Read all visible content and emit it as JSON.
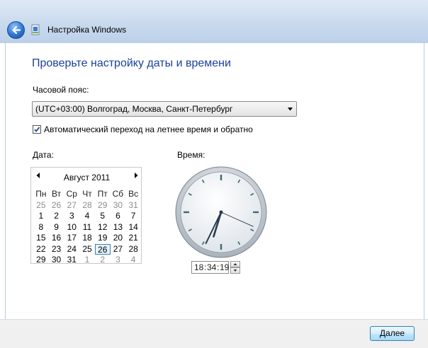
{
  "window": {
    "title": "Настройка Windows"
  },
  "page": {
    "title": "Проверьте настройку даты и времени"
  },
  "timezone": {
    "label": "Часовой пояс:",
    "value": "(UTC+03:00) Волгоград, Москва, Санкт-Петербург",
    "dst_checked": true,
    "dst_label": "Автоматический переход на летнее время и обратно"
  },
  "date": {
    "label": "Дата:",
    "month": "Август 2011",
    "weekdays": [
      "Пн",
      "Вт",
      "Ср",
      "Чт",
      "Пт",
      "Сб",
      "Вс"
    ],
    "days": [
      [
        "25",
        "26",
        "27",
        "28",
        "29",
        "30",
        "31"
      ],
      [
        "1",
        "2",
        "3",
        "4",
        "5",
        "6",
        "7"
      ],
      [
        "8",
        "9",
        "10",
        "11",
        "12",
        "13",
        "14"
      ],
      [
        "15",
        "16",
        "17",
        "18",
        "19",
        "20",
        "21"
      ],
      [
        "22",
        "23",
        "24",
        "25",
        "26",
        "27",
        "28"
      ],
      [
        "29",
        "30",
        "31",
        "1",
        "2",
        "3",
        "4"
      ]
    ],
    "selected_day": "26"
  },
  "time": {
    "label": "Время:",
    "hours": "18",
    "minutes": "34",
    "seconds": "19",
    "separator": ":"
  },
  "footer": {
    "next_label": "Далее"
  },
  "icons": {
    "back": "back-arrow-icon",
    "setup": "windows-setup-icon",
    "dropdown": "dropdown-arrow-icon",
    "checkmark": "checkmark-icon",
    "prev_month": "prev-month-arrow-icon",
    "next_month": "next-month-arrow-icon",
    "spin_up": "spin-up-icon",
    "spin_down": "spin-down-icon"
  },
  "colors": {
    "title_blue": "#1a3f9c",
    "selection_border": "#3c7fb1"
  }
}
